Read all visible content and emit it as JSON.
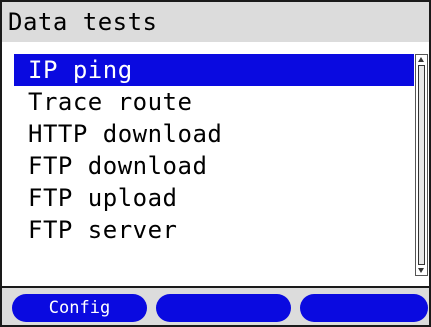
{
  "header": {
    "title": "Data tests"
  },
  "menu": {
    "items": [
      {
        "label": "IP ping",
        "selected": true
      },
      {
        "label": "Trace route",
        "selected": false
      },
      {
        "label": "HTTP download",
        "selected": false
      },
      {
        "label": "FTP download",
        "selected": false
      },
      {
        "label": "FTP upload",
        "selected": false
      },
      {
        "label": "FTP server",
        "selected": false
      }
    ]
  },
  "softkeys": {
    "key1_label": "Config",
    "key2_label": "",
    "key3_label": ""
  },
  "colors": {
    "selection": "#0a0ae0",
    "softkey": "#0a0ae0",
    "bar_background": "#dcdcdc"
  }
}
